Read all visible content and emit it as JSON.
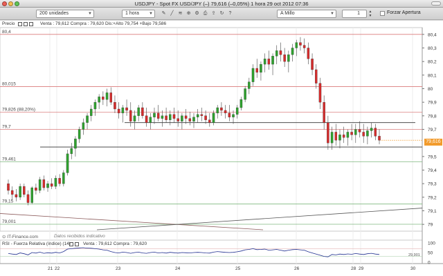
{
  "window": {
    "title": "USDJPY - Spot FX USD/JPY (–)  79,616 (–0,05%)  1 hora  29 oct 2012 07:36"
  },
  "toolbar": {
    "units_select": "200 unidades",
    "period_select": "1 hora",
    "order_select": "A Millo",
    "quantity": "1",
    "forzar_label": "Forzar Apertura"
  },
  "chart": {
    "precio_label": "Precio",
    "price_info": "Venta : 79,612 Compra : 79,620 Dis:+Alto 79,754 +Bajo 79,586",
    "source": "IT-Finance.com",
    "source_note": "Datos recibidos indicativo",
    "rsi_title": "RSI - Fuerza Relativa (índice) (14)",
    "rsi_info": "Venta : 79,612 Compra : 79,620",
    "current_price": "79,616",
    "left_labels": [
      {
        "text": "80,4",
        "value": 80.4
      },
      {
        "text": "80,015",
        "value": 80.015
      },
      {
        "text": "79,826 (88,20%)",
        "value": 79.826
      },
      {
        "text": "79,7",
        "value": 79.7
      },
      {
        "text": "79,461",
        "value": 79.461
      },
      {
        "text": "79,15",
        "value": 79.15
      },
      {
        "text": "79,001",
        "value": 79.001
      }
    ],
    "y_ticks": [
      {
        "text": "80,4",
        "value": 80.4
      },
      {
        "text": "80,3",
        "value": 80.3
      },
      {
        "text": "80,2",
        "value": 80.2
      },
      {
        "text": "80,1",
        "value": 80.1
      },
      {
        "text": "80",
        "value": 80.0
      },
      {
        "text": "79,9",
        "value": 79.9
      },
      {
        "text": "79,8",
        "value": 79.8
      },
      {
        "text": "79,7",
        "value": 79.7
      },
      {
        "text": "79,5",
        "value": 79.5
      },
      {
        "text": "79,4",
        "value": 79.4
      },
      {
        "text": "79,3",
        "value": 79.3
      },
      {
        "text": "79,2",
        "value": 79.2
      },
      {
        "text": "79,1",
        "value": 79.1
      },
      {
        "text": "79",
        "value": 79.0
      }
    ],
    "rsi_ticks": [
      "100",
      "50",
      "0"
    ],
    "rsi_right_label": "29,901",
    "x_ticks": [
      "21",
      "22",
      "23",
      "24",
      "25",
      "26",
      "28",
      "29",
      "30"
    ],
    "colors": {
      "up": "#2fa12f",
      "down": "#d62c2c",
      "current": "#f29b2c",
      "resistance": "#d97a7a",
      "support": "#7fb87f"
    }
  },
  "chart_data": {
    "type": "candlestick",
    "y_range": [
      78.95,
      80.45
    ],
    "rsi_range": [
      0,
      100
    ],
    "candles": [
      [
        79.3,
        79.33,
        79.22,
        79.25
      ],
      [
        79.25,
        79.28,
        79.18,
        79.22
      ],
      [
        79.22,
        79.26,
        79.17,
        79.2
      ],
      [
        79.2,
        79.3,
        79.18,
        79.28
      ],
      [
        79.28,
        79.3,
        79.2,
        79.22
      ],
      [
        79.22,
        79.25,
        79.14,
        79.16
      ],
      [
        79.16,
        79.28,
        79.15,
        79.27
      ],
      [
        79.27,
        79.3,
        79.22,
        79.25
      ],
      [
        79.25,
        79.35,
        79.23,
        79.33
      ],
      [
        79.33,
        79.36,
        79.25,
        79.27
      ],
      [
        79.27,
        79.32,
        79.24,
        79.3
      ],
      [
        79.3,
        79.34,
        79.26,
        79.28
      ],
      [
        79.28,
        79.36,
        79.26,
        79.34
      ],
      [
        79.34,
        79.37,
        79.28,
        79.3
      ],
      [
        79.3,
        79.4,
        79.28,
        79.38
      ],
      [
        79.38,
        79.55,
        79.36,
        79.52
      ],
      [
        79.52,
        79.6,
        79.48,
        79.56
      ],
      [
        79.56,
        79.65,
        79.5,
        79.63
      ],
      [
        79.63,
        79.72,
        79.6,
        79.7
      ],
      [
        79.7,
        79.78,
        79.66,
        79.75
      ],
      [
        79.75,
        79.82,
        79.7,
        79.8
      ],
      [
        79.8,
        79.88,
        79.76,
        79.85
      ],
      [
        79.85,
        79.92,
        79.8,
        79.9
      ],
      [
        79.9,
        79.96,
        79.85,
        79.94
      ],
      [
        79.94,
        79.98,
        79.88,
        79.92
      ],
      [
        79.92,
        80.0,
        79.87,
        79.97
      ],
      [
        79.97,
        80.01,
        79.88,
        79.9
      ],
      [
        79.9,
        79.95,
        79.82,
        79.85
      ],
      [
        79.85,
        79.9,
        79.78,
        79.82
      ],
      [
        79.82,
        79.88,
        79.75,
        79.86
      ],
      [
        79.86,
        79.92,
        79.8,
        79.84
      ],
      [
        79.84,
        79.9,
        79.72,
        79.76
      ],
      [
        79.76,
        79.84,
        79.7,
        79.8
      ],
      [
        79.8,
        79.88,
        79.76,
        79.86
      ],
      [
        79.86,
        79.9,
        79.78,
        79.8
      ],
      [
        79.8,
        79.86,
        79.72,
        79.75
      ],
      [
        79.75,
        79.82,
        79.7,
        79.79
      ],
      [
        79.79,
        79.86,
        79.74,
        79.82
      ],
      [
        79.82,
        79.88,
        79.76,
        79.78
      ],
      [
        79.78,
        79.84,
        79.72,
        79.8
      ],
      [
        79.8,
        79.86,
        79.75,
        79.77
      ],
      [
        79.77,
        79.84,
        79.73,
        79.81
      ],
      [
        79.81,
        79.86,
        79.75,
        79.78
      ],
      [
        79.78,
        79.84,
        79.72,
        79.76
      ],
      [
        79.76,
        79.82,
        79.7,
        79.8
      ],
      [
        79.8,
        79.85,
        79.74,
        79.78
      ],
      [
        79.78,
        79.83,
        79.73,
        79.76
      ],
      [
        79.76,
        79.82,
        79.71,
        79.79
      ],
      [
        79.79,
        79.85,
        79.75,
        79.81
      ],
      [
        79.81,
        79.86,
        79.76,
        79.8
      ],
      [
        79.8,
        79.84,
        79.74,
        79.77
      ],
      [
        79.77,
        79.82,
        79.72,
        79.75
      ],
      [
        79.75,
        79.84,
        79.73,
        79.82
      ],
      [
        79.82,
        79.88,
        79.78,
        79.86
      ],
      [
        79.86,
        79.9,
        79.8,
        79.84
      ],
      [
        79.84,
        79.88,
        79.78,
        79.82
      ],
      [
        79.82,
        79.88,
        79.76,
        79.79
      ],
      [
        79.79,
        79.84,
        79.74,
        79.81
      ],
      [
        79.81,
        79.88,
        79.78,
        79.86
      ],
      [
        79.86,
        79.94,
        79.84,
        79.92
      ],
      [
        79.92,
        80.02,
        79.9,
        80.0
      ],
      [
        80.0,
        80.08,
        79.96,
        80.05
      ],
      [
        80.05,
        80.18,
        80.02,
        80.15
      ],
      [
        80.15,
        80.22,
        80.08,
        80.12
      ],
      [
        80.12,
        80.2,
        80.06,
        80.18
      ],
      [
        80.18,
        80.26,
        80.12,
        80.22
      ],
      [
        80.22,
        80.28,
        80.14,
        80.18
      ],
      [
        80.18,
        80.26,
        80.1,
        80.24
      ],
      [
        80.24,
        80.32,
        80.18,
        80.28
      ],
      [
        80.28,
        80.34,
        80.2,
        80.25
      ],
      [
        80.25,
        80.3,
        80.16,
        80.2
      ],
      [
        80.2,
        80.28,
        80.12,
        80.25
      ],
      [
        80.25,
        80.33,
        80.2,
        80.3
      ],
      [
        80.3,
        80.36,
        80.24,
        80.34
      ],
      [
        80.34,
        80.38,
        80.28,
        80.32
      ],
      [
        80.32,
        80.37,
        80.26,
        80.3
      ],
      [
        80.3,
        80.34,
        80.18,
        80.22
      ],
      [
        80.22,
        80.26,
        80.1,
        80.14
      ],
      [
        80.14,
        80.18,
        80.0,
        80.04
      ],
      [
        80.04,
        80.08,
        79.85,
        79.9
      ],
      [
        79.9,
        79.95,
        79.7,
        79.75
      ],
      [
        79.75,
        79.8,
        79.55,
        79.6
      ],
      [
        79.6,
        79.72,
        79.55,
        79.68
      ],
      [
        79.68,
        79.74,
        79.58,
        79.62
      ],
      [
        79.62,
        79.7,
        79.56,
        79.66
      ],
      [
        79.66,
        79.72,
        79.6,
        79.64
      ],
      [
        79.64,
        79.7,
        79.58,
        79.68
      ],
      [
        79.68,
        79.74,
        79.62,
        79.66
      ],
      [
        79.66,
        79.74,
        79.6,
        79.7
      ],
      [
        79.7,
        79.76,
        79.64,
        79.68
      ],
      [
        79.68,
        79.74,
        79.6,
        79.65
      ],
      [
        79.65,
        79.72,
        79.59,
        79.69
      ],
      [
        79.69,
        79.75,
        79.64,
        79.71
      ],
      [
        79.71,
        79.74,
        79.62,
        79.65
      ],
      [
        79.65,
        79.7,
        79.59,
        79.62
      ]
    ],
    "rsi": [
      45,
      42,
      40,
      48,
      44,
      38,
      50,
      47,
      52,
      46,
      49,
      47,
      51,
      48,
      55,
      68,
      70,
      72,
      74,
      75,
      73,
      72,
      70,
      68,
      64,
      62,
      55,
      50,
      48,
      52,
      50,
      46,
      50,
      52,
      48,
      46,
      50,
      52,
      48,
      50,
      47,
      51,
      49,
      47,
      50,
      49,
      48,
      50,
      51,
      50,
      48,
      47,
      52,
      55,
      53,
      51,
      50,
      51,
      54,
      58,
      64,
      66,
      70,
      65,
      66,
      68,
      62,
      64,
      66,
      62,
      58,
      62,
      65,
      66,
      64,
      62,
      54,
      48,
      42,
      36,
      30,
      28,
      40,
      38,
      42,
      40,
      43,
      41,
      45,
      42,
      40,
      44,
      46,
      42,
      40
    ],
    "resistance_levels": [
      80.4,
      80.015,
      79.826,
      79.7
    ],
    "support_levels": [
      79.461,
      79.15,
      79.001
    ]
  }
}
